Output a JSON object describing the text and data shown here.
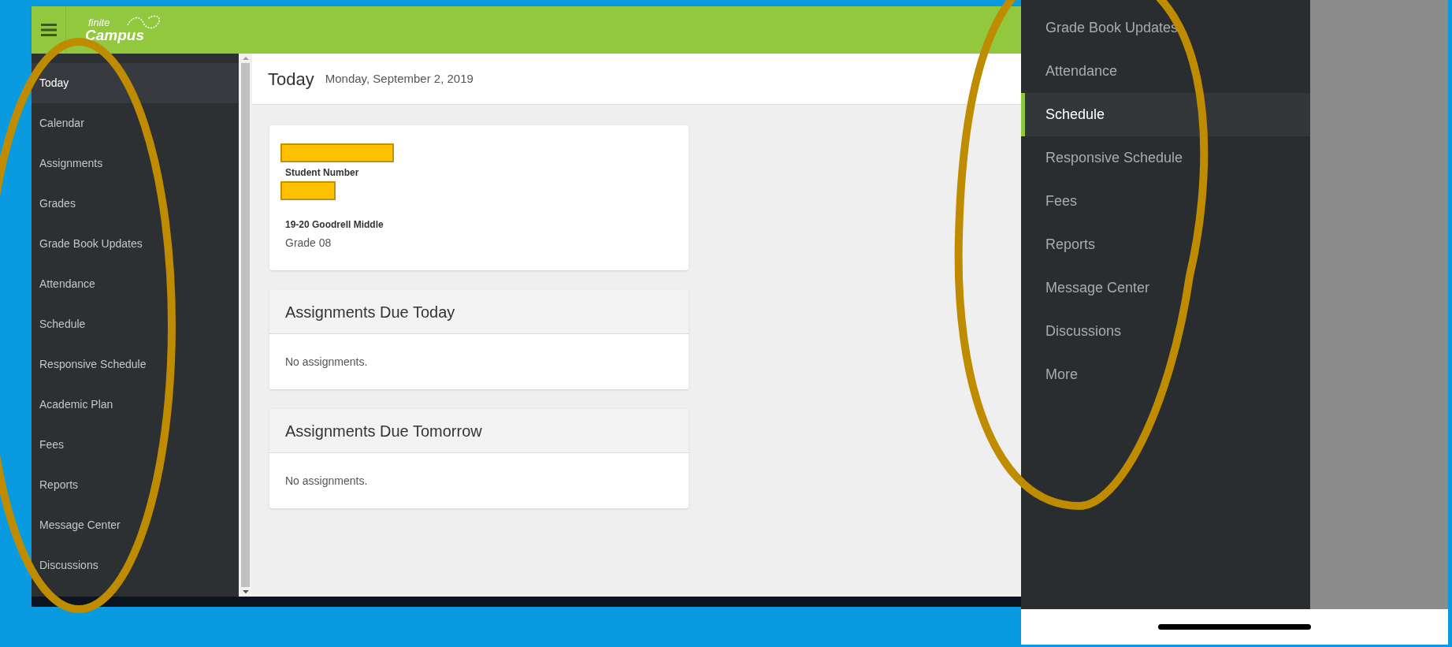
{
  "desktop_screenshot": {
    "header": {
      "logo_top": "finite",
      "logo_bottom": "Campus"
    },
    "sidebar": {
      "items": [
        {
          "label": "Today",
          "selected": true
        },
        {
          "label": "Calendar",
          "selected": false
        },
        {
          "label": "Assignments",
          "selected": false
        },
        {
          "label": "Grades",
          "selected": false
        },
        {
          "label": "Grade Book Updates",
          "selected": false
        },
        {
          "label": "Attendance",
          "selected": false
        },
        {
          "label": "Schedule",
          "selected": false
        },
        {
          "label": "Responsive Schedule",
          "selected": false
        },
        {
          "label": "Academic Plan",
          "selected": false
        },
        {
          "label": "Fees",
          "selected": false
        },
        {
          "label": "Reports",
          "selected": false
        },
        {
          "label": "Message Center",
          "selected": false
        },
        {
          "label": "Discussions",
          "selected": false
        }
      ]
    },
    "page_title": "Today",
    "date": "Monday, September 2, 2019",
    "student_card": {
      "student_number_label": "Student Number",
      "school": "19-20 Goodrell Middle",
      "grade": "Grade 08"
    },
    "panels": [
      {
        "title": "Assignments Due Today",
        "body": "No assignments."
      },
      {
        "title": "Assignments Due Tomorrow",
        "body": "No assignments."
      }
    ]
  },
  "phone_screenshot": {
    "menu": [
      {
        "label": "Grade Book Updates",
        "selected": false
      },
      {
        "label": "Attendance",
        "selected": false
      },
      {
        "label": "Schedule",
        "selected": true
      },
      {
        "label": "Responsive Schedule",
        "selected": false
      },
      {
        "label": "Fees",
        "selected": false
      },
      {
        "label": "Reports",
        "selected": false
      },
      {
        "label": "Message Center",
        "selected": false
      },
      {
        "label": "Discussions",
        "selected": false
      },
      {
        "label": "More",
        "selected": false
      }
    ]
  }
}
